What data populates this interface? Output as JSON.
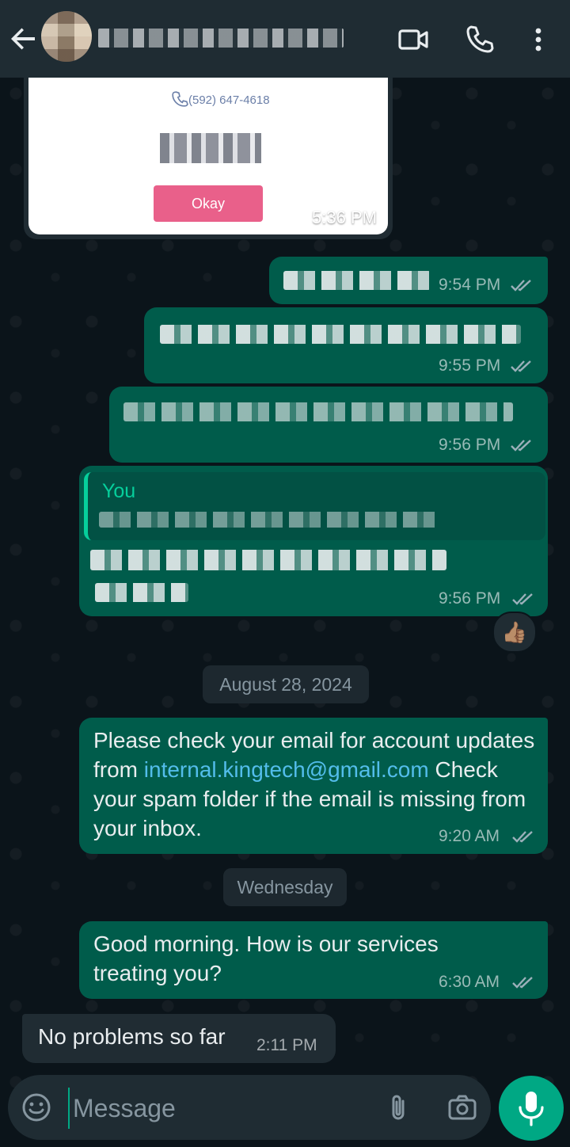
{
  "header": {
    "contact_name": "",
    "icons": [
      "back-arrow-icon",
      "video-call-icon",
      "voice-call-icon",
      "more-options-icon"
    ]
  },
  "image_message": {
    "phone": "(592) 647-4618",
    "button_label": "Okay",
    "time": "5:36 PM"
  },
  "messages": [
    {
      "direction": "out",
      "time": "9:54 PM",
      "status": "read"
    },
    {
      "direction": "out",
      "time": "9:55 PM",
      "status": "read"
    },
    {
      "direction": "out",
      "time": "9:56 PM",
      "status": "read"
    },
    {
      "direction": "out",
      "time": "9:56 PM",
      "status": "read",
      "quote_author": "You",
      "reaction": "👍🏽"
    },
    {
      "direction": "out",
      "time": "9:20 AM",
      "status": "read",
      "text_before": "Please check your email for account updates from ",
      "link": "internal.kingtech@gmail.com",
      "text_after": " Check your  spam folder if the email is missing from your inbox."
    },
    {
      "direction": "out",
      "time": "6:30 AM",
      "status": "read",
      "text": "Good morning. How is our services treating you?"
    },
    {
      "direction": "in",
      "time": "2:11 PM",
      "text": "No problems so far"
    }
  ],
  "date_separators": [
    "August 28, 2024",
    "Wednesday"
  ],
  "composer": {
    "placeholder": "Message",
    "icons": [
      "emoji-icon",
      "attach-icon",
      "camera-icon",
      "mic-icon"
    ]
  },
  "colors": {
    "outgoing_bubble": "#005c4b",
    "incoming_bubble": "#202c33",
    "accent": "#00a884",
    "link": "#53bdeb"
  }
}
